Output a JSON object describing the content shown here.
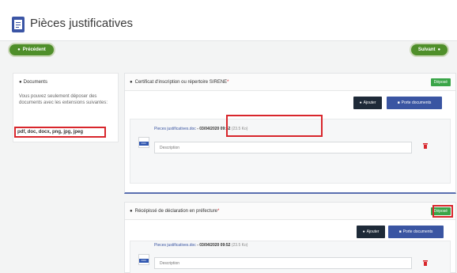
{
  "header": {
    "title": "Pièces justificatives"
  },
  "nav": {
    "prev_label": "Précédent",
    "next_label": "Suivant"
  },
  "sidebar": {
    "title": "Documents",
    "text": "Vous pouvez seulement déposer des documents avec les extensions suivantes:",
    "extensions": "pdf, doc, docx, png, jpg, jpeg"
  },
  "cards": [
    {
      "title": "Certificat d'inscription ou répertoire SIRENE",
      "required_mark": "*",
      "badge": "Déposé",
      "add_label": "Ajouter",
      "docs_label": "Porte documents",
      "file_name": "Pieces justificatives.doc",
      "file_date": " - 03/04/2020 09:52",
      "file_size": " (23.5 Ko)",
      "thumb_label": "DOC",
      "description_placeholder": "Description"
    },
    {
      "title": "Récépissé de déclaration en préfecture",
      "required_mark": "*",
      "badge": "Déposé",
      "add_label": "Ajouter",
      "docs_label": "Porte documents",
      "file_name": "Pieces justificatives.doc",
      "file_date": " - 03/04/2020 09:52",
      "file_size": " (23.5 Ko)",
      "thumb_label": "DOC",
      "description_placeholder": "Description"
    }
  ],
  "colors": {
    "primary": "#3a55a2",
    "success": "#3aa548",
    "highlight": "#d8262c",
    "dark": "#1e2a38"
  }
}
